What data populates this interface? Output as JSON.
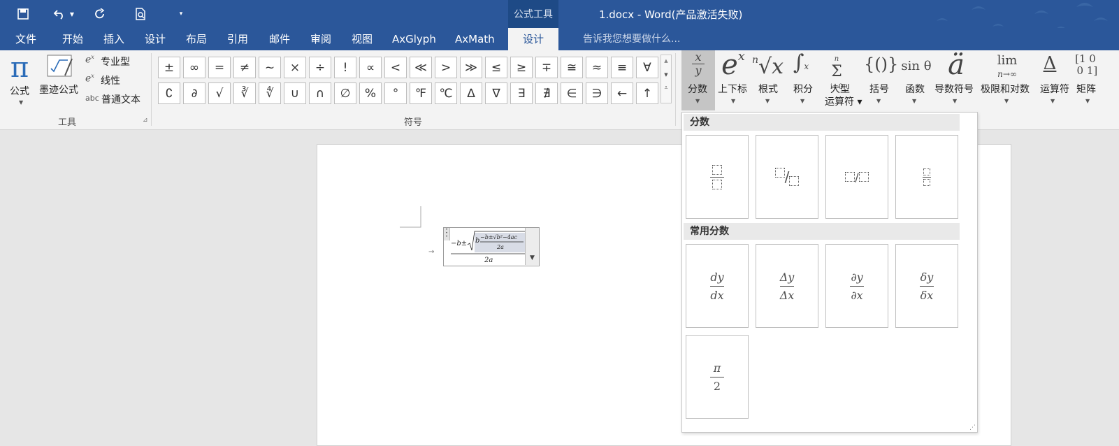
{
  "title_bar": {
    "context_tab": "公式工具",
    "document_title": "1.docx - Word(产品激活失败)"
  },
  "menu": {
    "tabs": [
      "文件",
      "开始",
      "插入",
      "设计",
      "布局",
      "引用",
      "邮件",
      "审阅",
      "视图",
      "AxGlyph",
      "AxMath",
      "设计"
    ],
    "active_index": 11,
    "tell_me": "告诉我您想要做什么..."
  },
  "tools_group": {
    "formula_label": "公式",
    "ink_label": "墨迹公式",
    "professional_label": "专业型",
    "linear_label": "线性",
    "normal_text_label": "普通文本",
    "group_name": "工具"
  },
  "symbols_group": {
    "row1": [
      "±",
      "∞",
      "=",
      "≠",
      "~",
      "×",
      "÷",
      "!",
      "∝",
      "<",
      "≪",
      ">",
      "≫",
      "≤",
      "≥",
      "∓",
      "≅",
      "≈",
      "≡",
      "∀"
    ],
    "row2": [
      "∁",
      "∂",
      "√",
      "∛",
      "∜",
      "∪",
      "∩",
      "∅",
      "%",
      "°",
      "℉",
      "℃",
      "∆",
      "∇",
      "∃",
      "∄",
      "∈",
      "∋",
      "←",
      "↑"
    ],
    "group_name": "符号"
  },
  "structures": [
    {
      "label": "分数",
      "icon": "fraction-icon"
    },
    {
      "label": "上下标",
      "icon": "script-icon"
    },
    {
      "label": "根式",
      "icon": "radical-icon"
    },
    {
      "label": "积分",
      "icon": "integral-icon"
    },
    {
      "label": "大型\n运算符",
      "icon": "large-operator-icon"
    },
    {
      "label": "括号",
      "icon": "bracket-icon"
    },
    {
      "label": "函数",
      "icon": "function-icon"
    },
    {
      "label": "导数符号",
      "icon": "accent-icon"
    },
    {
      "label": "极限和对数",
      "icon": "limit-icon"
    },
    {
      "label": "运算符",
      "icon": "operator-icon"
    },
    {
      "label": "矩阵",
      "icon": "matrix-icon"
    }
  ],
  "dropdown": {
    "section1_title": "分数",
    "section2_title": "常用分数",
    "common": [
      {
        "num": "dy",
        "den": "dx"
      },
      {
        "num": "Δy",
        "den": "Δx"
      },
      {
        "num": "∂y",
        "den": "∂x"
      },
      {
        "num": "δy",
        "den": "δx"
      },
      {
        "num": "π",
        "den": "2"
      }
    ]
  },
  "equation": {
    "text": "−b±√(b(−b±√(b²−4ac))/2a) / 2a"
  }
}
